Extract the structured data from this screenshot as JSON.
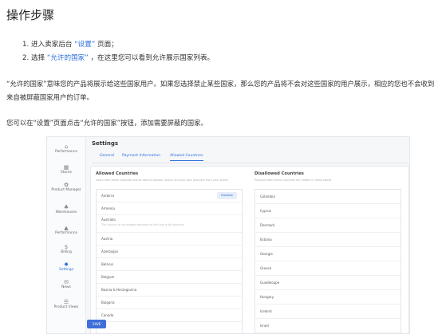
{
  "heading": "操作步骤",
  "steps": [
    {
      "num": "1.",
      "pre": "进入卖家后台 ",
      "quote": "“设置”",
      "post": " 页面；"
    },
    {
      "num": "2.",
      "pre": "选择 ",
      "quote": "“允许的国家”",
      "post": " ，在这里您可以看到允许展示国家列表。"
    }
  ],
  "paragraph1": "“允许的国家”意味您的产品将展示给这些国家用户。如果您选择禁止某些国家，那么您的产品将不会对这些国家的用户展示，相应的您也不会收到来自被屏蔽国家用户的订单。",
  "paragraph2": "您可以在“设置”页面点击“允许的国家”按钮，添加需要屏蔽的国家。",
  "screenshot": {
    "settings_title": "Settings",
    "tabs": [
      "General",
      "Payment Information",
      "Allowed Countries"
    ],
    "active_tab": 2,
    "sidebar": [
      {
        "icon": "home-icon",
        "glyph": "⌂",
        "label": "Performance"
      },
      {
        "icon": "store-icon",
        "glyph": "▦",
        "label": "Stores"
      },
      {
        "icon": "product-icon",
        "glyph": "✿",
        "label": "Product Manager"
      },
      {
        "icon": "warehouse-icon",
        "glyph": "♣",
        "label": "Warehouses"
      },
      {
        "icon": "performance-icon",
        "glyph": "▲",
        "label": "Performance"
      },
      {
        "icon": "billing-icon",
        "glyph": "$",
        "label": "Billing"
      },
      {
        "icon": "settings-icon",
        "glyph": "✸",
        "label": "Settings"
      },
      {
        "icon": "news-icon",
        "glyph": "✉",
        "label": "News"
      },
      {
        "icon": "product-views-icon",
        "glyph": "☰",
        "label": "Product Views"
      }
    ],
    "active_sidebar": 6,
    "allowed_title": "Allowed Countries",
    "allowed_desc": "Users from these countries will be able to browse, search and buy your products from your stores",
    "allowed_countries": [
      {
        "name": "Andorra",
        "sub": ""
      },
      {
        "name": "Armenia",
        "sub": ""
      },
      {
        "name": "Australia",
        "sub": "The country is not allowed because its first sale is still pending"
      },
      {
        "name": "Austria",
        "sub": ""
      },
      {
        "name": "Azerbaijan",
        "sub": ""
      },
      {
        "name": "Belarus",
        "sub": ""
      },
      {
        "name": "Belgium",
        "sub": ""
      },
      {
        "name": "Bosnia & Herzegovina",
        "sub": ""
      },
      {
        "name": "Bulgaria",
        "sub": ""
      },
      {
        "name": "Canada",
        "sub": ""
      }
    ],
    "disable_label": "Disallow",
    "disallowed_title": "Disallowed Countries",
    "disallowed_desc": "Products from these countries are hidden in these stores",
    "disallowed_countries": [
      "Colombia",
      "Cyprus",
      "Denmark",
      "Estonia",
      "Georgia",
      "Greece",
      "Guadeloupe",
      "Hungary",
      "Iceland",
      "Israel"
    ],
    "save_label": "SAVE"
  }
}
